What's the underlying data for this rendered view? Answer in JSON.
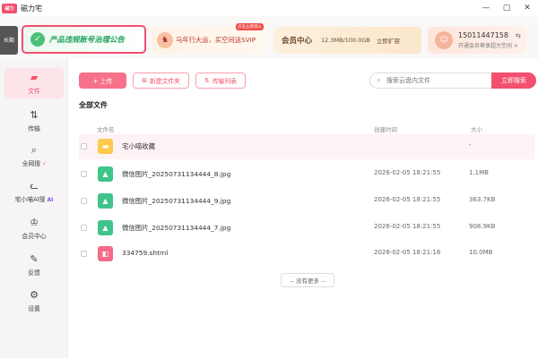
{
  "app": {
    "logo_text": "磁力",
    "title": "磁力宅"
  },
  "window": {
    "min": "—",
    "max": "▢",
    "close": "✕"
  },
  "header": {
    "news_label": "长期",
    "banner_notice": "产品违规账号治理公告",
    "promo_text": "马年行大运，买空间送SVIP",
    "promo_tag": "点击立即领入",
    "vip": {
      "title": "会员中心",
      "storage": "12.3MB/100.0GB",
      "expand": "立即扩容"
    },
    "user": {
      "phone": "15011447158",
      "arrow": "⇆",
      "subtitle": "开通会员尊享超大空间 >"
    }
  },
  "sidebar": {
    "items": [
      {
        "label": "文件",
        "icon": "folder-icon",
        "glyph": "▰",
        "extra": ""
      },
      {
        "label": "传输",
        "icon": "transfer-icon",
        "glyph": "⇅",
        "extra": ""
      },
      {
        "label": "全网搜",
        "icon": "search-icon",
        "glyph": "⌕",
        "extra": "⚡"
      },
      {
        "label": "宅小喵AI搜",
        "icon": "cat-icon",
        "glyph": "ᓚ",
        "extra": "AI"
      },
      {
        "label": "会员中心",
        "icon": "crown-icon",
        "glyph": "♔",
        "extra": ""
      },
      {
        "label": "反馈",
        "icon": "feedback-icon",
        "glyph": "✎",
        "extra": ""
      },
      {
        "label": "设置",
        "icon": "gear-icon",
        "glyph": "⚙",
        "extra": ""
      }
    ]
  },
  "toolbar": {
    "upload": "+ 上传",
    "new_folder": "新建文件夹",
    "transfer_list": "传输列表",
    "search_placeholder": "搜索云盘内文件",
    "search_button": "立即搜索"
  },
  "main": {
    "section_title": "全部文件",
    "columns": {
      "name": "文件名",
      "time": "创建时间",
      "size": "大小"
    },
    "rows": [
      {
        "name": "宅小喵收藏",
        "time": "",
        "size": "-",
        "type": "folder"
      },
      {
        "name": "微信图片_20250731134444_8.jpg",
        "time": "2026-02-05 18:21:55",
        "size": "1.1MB",
        "type": "image"
      },
      {
        "name": "微信图片_20250731134444_9.jpg",
        "time": "2026-02-05 18:21:55",
        "size": "363.7KB",
        "type": "image"
      },
      {
        "name": "微信图片_20250731134444_7.jpg",
        "time": "2026-02-05 18:21:55",
        "size": "908.9KB",
        "type": "image"
      },
      {
        "name": "334759.shtml",
        "time": "2026-02-05 18:21:16",
        "size": "10.0MB",
        "type": "html"
      }
    ],
    "no_more": "-- 没有更多 --"
  },
  "colors": {
    "accent": "#f2506e",
    "folder": "#ffc94d",
    "image": "#3fc48a",
    "html": "#f46b8a"
  }
}
